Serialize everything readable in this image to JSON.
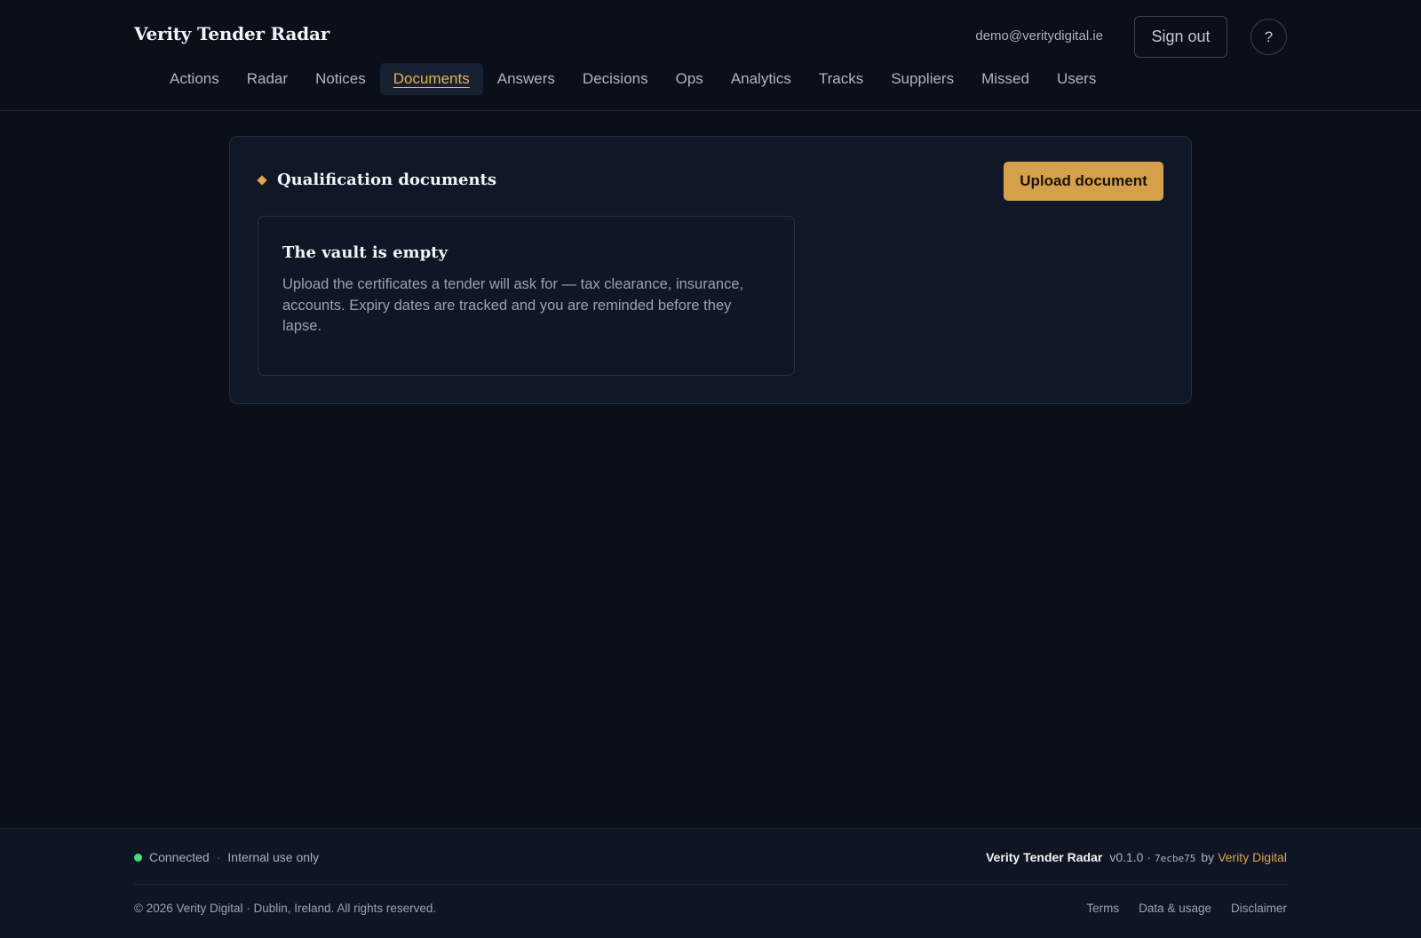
{
  "header": {
    "brand": "Verity Tender Radar",
    "user_email": "demo@veritydigital.ie",
    "signout_label": "Sign out",
    "help_label": "?"
  },
  "nav": {
    "items": [
      {
        "label": "Actions",
        "active": false
      },
      {
        "label": "Radar",
        "active": false
      },
      {
        "label": "Notices",
        "active": false
      },
      {
        "label": "Documents",
        "active": true
      },
      {
        "label": "Answers",
        "active": false
      },
      {
        "label": "Decisions",
        "active": false
      },
      {
        "label": "Ops",
        "active": false
      },
      {
        "label": "Analytics",
        "active": false
      },
      {
        "label": "Tracks",
        "active": false
      },
      {
        "label": "Suppliers",
        "active": false
      },
      {
        "label": "Missed",
        "active": false
      },
      {
        "label": "Users",
        "active": false
      }
    ]
  },
  "main": {
    "title": "Qualification documents",
    "title_icon": "diamond-icon",
    "upload_label": "Upload document",
    "empty": {
      "title": "The vault is empty",
      "text": "Upload the certificates a tender will ask for — tax clearance, insurance, accounts. Expiry dates are tracked and you are reminded before they lapse."
    }
  },
  "footer": {
    "status": "Connected",
    "status_color": "#4ade80",
    "scope": "Internal use only",
    "app_name": "Verity Tender Radar",
    "version": "v0.1.0 ·",
    "hash": "7ecbe75",
    "by": "by",
    "vendor": "Verity Digital",
    "copyright": "© 2026 Verity Digital · Dublin, Ireland. All rights reserved.",
    "links": [
      "Terms",
      "Data & usage",
      "Disclaimer"
    ]
  },
  "colors": {
    "background": "#0a0f1a",
    "accent": "#d5a04a",
    "active_nav_text": "#e5b154"
  }
}
